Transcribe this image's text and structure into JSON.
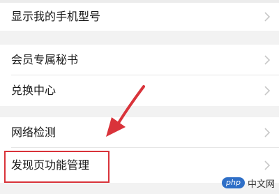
{
  "settings": {
    "group1": [
      {
        "label": "显示我的手机型号"
      }
    ],
    "group2": [
      {
        "label": "会员专属秘书"
      },
      {
        "label": "兑换中心"
      }
    ],
    "group3": [
      {
        "label": "网络检测"
      },
      {
        "label": "发现页功能管理"
      }
    ]
  },
  "annotation": {
    "highlight_color": "#d9333a",
    "highlighted_item": "发现页功能管理"
  },
  "watermark": {
    "badge": "php",
    "text": "中文网"
  },
  "icons": {
    "chevron": "chevron-right-icon"
  }
}
